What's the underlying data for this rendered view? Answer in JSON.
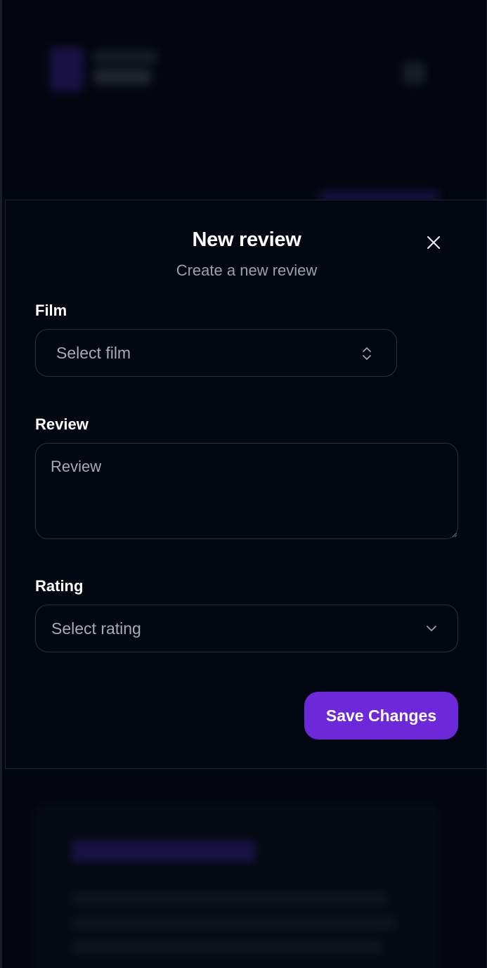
{
  "dialog": {
    "title": "New review",
    "subtitle": "Create a new review",
    "close_icon": "close-icon"
  },
  "form": {
    "film": {
      "label": "Film",
      "selected": "Select film",
      "icon": "chevron-up-down-icon"
    },
    "review": {
      "label": "Review",
      "placeholder": "Review",
      "value": ""
    },
    "rating": {
      "label": "Rating",
      "selected": "Select rating",
      "icon": "chevron-down-icon"
    },
    "save_label": "Save Changes"
  },
  "colors": {
    "background": "#03060f",
    "dialog": "#030712",
    "border": "#2a303c",
    "accent": "#6d28d9",
    "muted_text": "#9aa0ad"
  }
}
